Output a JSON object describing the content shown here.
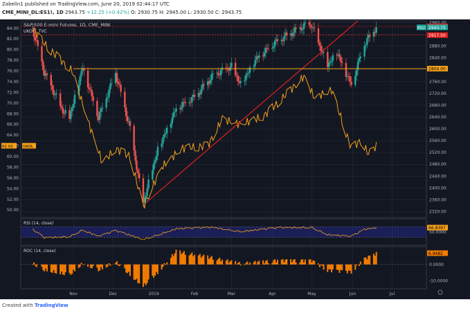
{
  "header": {
    "publisher": "Zabelin1 published on TradingView.com, June 20, 2019 02:44:17 UTC",
    "symbol": "CME_MINI_DL:ES1!, 1D",
    "last": "2943.75",
    "change": "+12.25 (+0.42%)",
    "ohlc": "O: 2930.75  H: 2945.00  L: 2930.50  C: 2943.75"
  },
  "footer": {
    "created_with": "Created with",
    "brand": "TradingView"
  },
  "colors": {
    "background": "#131722",
    "grid": "#2a2e39",
    "axis_text": "#b2b5be",
    "up": "#26a69a",
    "down": "#ef5350",
    "wti": "#f7a21b",
    "hline_red": "#e02020",
    "hline_orange": "#f7a21b",
    "rsi_band": "#1e2266",
    "roc": "#f57c00"
  },
  "chart_data": [
    {
      "type": "candlestick",
      "title": "S&P 500 E-mini Futures, 1D, CME_MINI",
      "series2_label": "UKOIL, TVC",
      "x_ticks": [
        "Nov",
        "Dec",
        "2019",
        "Feb",
        "Mar",
        "Apr",
        "May",
        "Jun",
        "Jul"
      ],
      "left_axis": {
        "label": "UKOIL",
        "ticks": [
          50.0,
          52.0,
          54.0,
          56.0,
          58.0,
          60.0,
          62.0,
          64.0,
          66.0,
          68.0,
          70.0,
          72.0,
          74.0,
          76.0,
          78.0,
          80.0,
          82.0,
          84.0
        ],
        "range": [
          48.6,
          85.4
        ]
      },
      "right_axis": {
        "label": "ES1!",
        "ticks": [
          2320.0,
          2360.0,
          2400.0,
          2440.0,
          2480.0,
          2520.0,
          2560.0,
          2600.0,
          2640.0,
          2680.0,
          2720.0,
          2760.0,
          2800.0,
          2840.0,
          2880.0,
          2920.0,
          2960.0
        ],
        "range": [
          2300,
          2966
        ]
      },
      "horizontal_levels": [
        {
          "value": 2947.0,
          "label": "2947.00",
          "color": "red"
        },
        {
          "value": 2917.5,
          "label": "2917.50",
          "color": "red"
        },
        {
          "value": 2804.0,
          "label": "2804.00",
          "color": "orange"
        }
      ],
      "price_tag": {
        "value": 2943.75,
        "label": "2943.75",
        "symbol": "ES1!"
      },
      "ukoil_tag": {
        "value": 62.02,
        "label": "62.02",
        "symbol": "UKOIL"
      },
      "trendline": {
        "from": {
          "date": "2018-12-26",
          "value": 2350
        },
        "to": {
          "date": "2019-06-05",
          "value": 2966
        }
      },
      "es_close_path": [
        {
          "date": "2018-10-01",
          "value": 2940
        },
        {
          "date": "2018-10-10",
          "value": 2790
        },
        {
          "date": "2018-10-24",
          "value": 2660
        },
        {
          "date": "2018-10-29",
          "value": 2640
        },
        {
          "date": "2018-11-08",
          "value": 2810
        },
        {
          "date": "2018-11-20",
          "value": 2640
        },
        {
          "date": "2018-12-03",
          "value": 2790
        },
        {
          "date": "2018-12-14",
          "value": 2600
        },
        {
          "date": "2018-12-21",
          "value": 2420
        },
        {
          "date": "2018-12-24",
          "value": 2350
        },
        {
          "date": "2019-01-04",
          "value": 2530
        },
        {
          "date": "2019-01-18",
          "value": 2670
        },
        {
          "date": "2019-02-01",
          "value": 2710
        },
        {
          "date": "2019-02-15",
          "value": 2780
        },
        {
          "date": "2019-03-01",
          "value": 2810
        },
        {
          "date": "2019-03-08",
          "value": 2750
        },
        {
          "date": "2019-03-20",
          "value": 2840
        },
        {
          "date": "2019-04-05",
          "value": 2900
        },
        {
          "date": "2019-04-26",
          "value": 2950
        },
        {
          "date": "2019-05-01",
          "value": 2950
        },
        {
          "date": "2019-05-07",
          "value": 2880
        },
        {
          "date": "2019-05-13",
          "value": 2815
        },
        {
          "date": "2019-05-20",
          "value": 2860
        },
        {
          "date": "2019-05-31",
          "value": 2750
        },
        {
          "date": "2019-06-10",
          "value": 2890
        },
        {
          "date": "2019-06-19",
          "value": 2943.75
        }
      ],
      "ukoil_path": [
        {
          "date": "2018-10-01",
          "value": 84.0
        },
        {
          "date": "2018-10-12",
          "value": 80.5
        },
        {
          "date": "2018-10-31",
          "value": 76.0
        },
        {
          "date": "2018-11-13",
          "value": 66.0
        },
        {
          "date": "2018-11-23",
          "value": 58.8
        },
        {
          "date": "2018-12-03",
          "value": 61.5
        },
        {
          "date": "2018-12-14",
          "value": 60.0
        },
        {
          "date": "2018-12-24",
          "value": 50.6
        },
        {
          "date": "2019-01-07",
          "value": 58.0
        },
        {
          "date": "2019-01-22",
          "value": 61.5
        },
        {
          "date": "2019-02-11",
          "value": 62.0
        },
        {
          "date": "2019-02-22",
          "value": 67.0
        },
        {
          "date": "2019-03-08",
          "value": 66.0
        },
        {
          "date": "2019-03-25",
          "value": 67.5
        },
        {
          "date": "2019-04-05",
          "value": 70.0
        },
        {
          "date": "2019-04-25",
          "value": 75.0
        },
        {
          "date": "2019-05-03",
          "value": 71.0
        },
        {
          "date": "2019-05-16",
          "value": 72.5
        },
        {
          "date": "2019-05-31",
          "value": 61.5
        },
        {
          "date": "2019-06-07",
          "value": 63.0
        },
        {
          "date": "2019-06-13",
          "value": 60.5
        },
        {
          "date": "2019-06-19",
          "value": 62.02
        }
      ]
    },
    {
      "type": "line",
      "title": "RSI (14, close)",
      "last_value_label": "66.8397",
      "tick_labels": [
        "50.0000"
      ],
      "bands": [
        30,
        70
      ],
      "path": [
        {
          "date": "2018-10-01",
          "value": 60
        },
        {
          "date": "2018-10-10",
          "value": 28
        },
        {
          "date": "2018-10-29",
          "value": 33
        },
        {
          "date": "2018-11-08",
          "value": 58
        },
        {
          "date": "2018-11-20",
          "value": 34
        },
        {
          "date": "2018-12-03",
          "value": 55
        },
        {
          "date": "2018-12-24",
          "value": 22
        },
        {
          "date": "2019-01-18",
          "value": 62
        },
        {
          "date": "2019-02-15",
          "value": 68
        },
        {
          "date": "2019-03-08",
          "value": 52
        },
        {
          "date": "2019-04-05",
          "value": 66
        },
        {
          "date": "2019-05-01",
          "value": 68
        },
        {
          "date": "2019-05-13",
          "value": 40
        },
        {
          "date": "2019-05-31",
          "value": 33
        },
        {
          "date": "2019-06-10",
          "value": 60
        },
        {
          "date": "2019-06-19",
          "value": 66.84
        }
      ]
    },
    {
      "type": "bar",
      "title": "ROC (14, close)",
      "last_value_label": "6.9482",
      "tick_labels": [
        "0.0000",
        "-10.0000"
      ],
      "path": [
        {
          "date": "2018-10-01",
          "value": 0.5
        },
        {
          "date": "2018-10-10",
          "value": -3.5
        },
        {
          "date": "2018-10-29",
          "value": -6.5
        },
        {
          "date": "2018-11-08",
          "value": 0.5
        },
        {
          "date": "2018-11-20",
          "value": -3.5
        },
        {
          "date": "2018-12-03",
          "value": 1.5
        },
        {
          "date": "2018-12-24",
          "value": -13.5
        },
        {
          "date": "2019-01-04",
          "value": -5.0
        },
        {
          "date": "2019-01-18",
          "value": 8.0
        },
        {
          "date": "2019-02-15",
          "value": 4.0
        },
        {
          "date": "2019-03-08",
          "value": 0.5
        },
        {
          "date": "2019-04-05",
          "value": 2.5
        },
        {
          "date": "2019-05-01",
          "value": 2.5
        },
        {
          "date": "2019-05-13",
          "value": -3.5
        },
        {
          "date": "2019-05-31",
          "value": -4.5
        },
        {
          "date": "2019-06-10",
          "value": 3.5
        },
        {
          "date": "2019-06-19",
          "value": 6.95
        }
      ],
      "range": [
        -15,
        11
      ]
    }
  ]
}
